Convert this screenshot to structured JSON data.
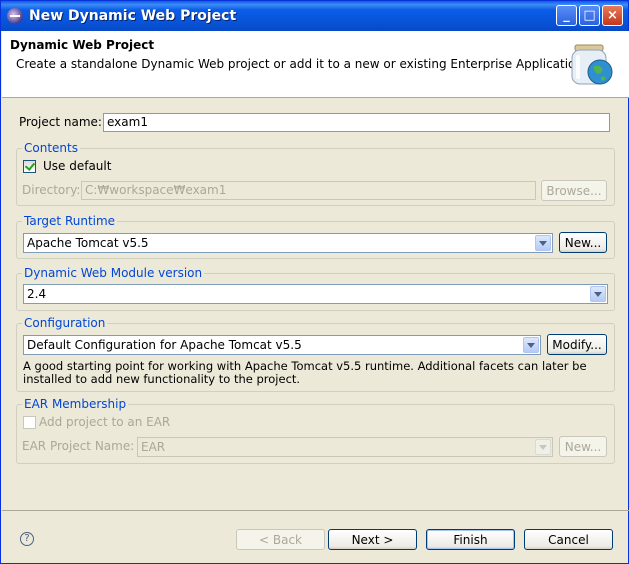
{
  "window": {
    "title": "New Dynamic Web Project",
    "controls": {
      "minimize": "_",
      "maximize": "□",
      "close": "×"
    }
  },
  "banner": {
    "title": "Dynamic Web Project",
    "description": "Create a standalone Dynamic Web project or add it to a new or existing Enterprise Application.",
    "icon": "jar-globe-icon"
  },
  "project": {
    "name_label": "Project name:",
    "name_value": "exam1"
  },
  "contents": {
    "title": "Contents",
    "use_default_label": "Use default",
    "use_default_checked": true,
    "directory_label": "Directory:",
    "directory_value": "C:₩workspace₩exam1",
    "browse_label": "Browse..."
  },
  "target_runtime": {
    "title": "Target Runtime",
    "selected": "Apache Tomcat v5.5",
    "new_label": "New..."
  },
  "web_module": {
    "title": "Dynamic Web Module version",
    "selected": "2.4"
  },
  "configuration": {
    "title": "Configuration",
    "selected": "Default Configuration for Apache Tomcat v5.5",
    "modify_label": "Modify...",
    "description_line1": "A good starting point for working with Apache Tomcat v5.5 runtime. Additional facets can later be",
    "description_line2": "installed to add new functionality to the project."
  },
  "ear": {
    "title": "EAR Membership",
    "add_label": "Add project to an EAR",
    "add_checked": false,
    "project_name_label": "EAR Project Name:",
    "project_name_value": "EAR",
    "new_label": "New..."
  },
  "footer": {
    "help_icon": "help-icon",
    "help_glyph": "?",
    "back_label": "< Back",
    "next_label": "Next >",
    "finish_label": "Finish",
    "cancel_label": "Cancel"
  },
  "colors": {
    "titlebar": "#0a5ce8",
    "group_title": "#0046d5",
    "dialog_bg": "#ece9d8"
  }
}
